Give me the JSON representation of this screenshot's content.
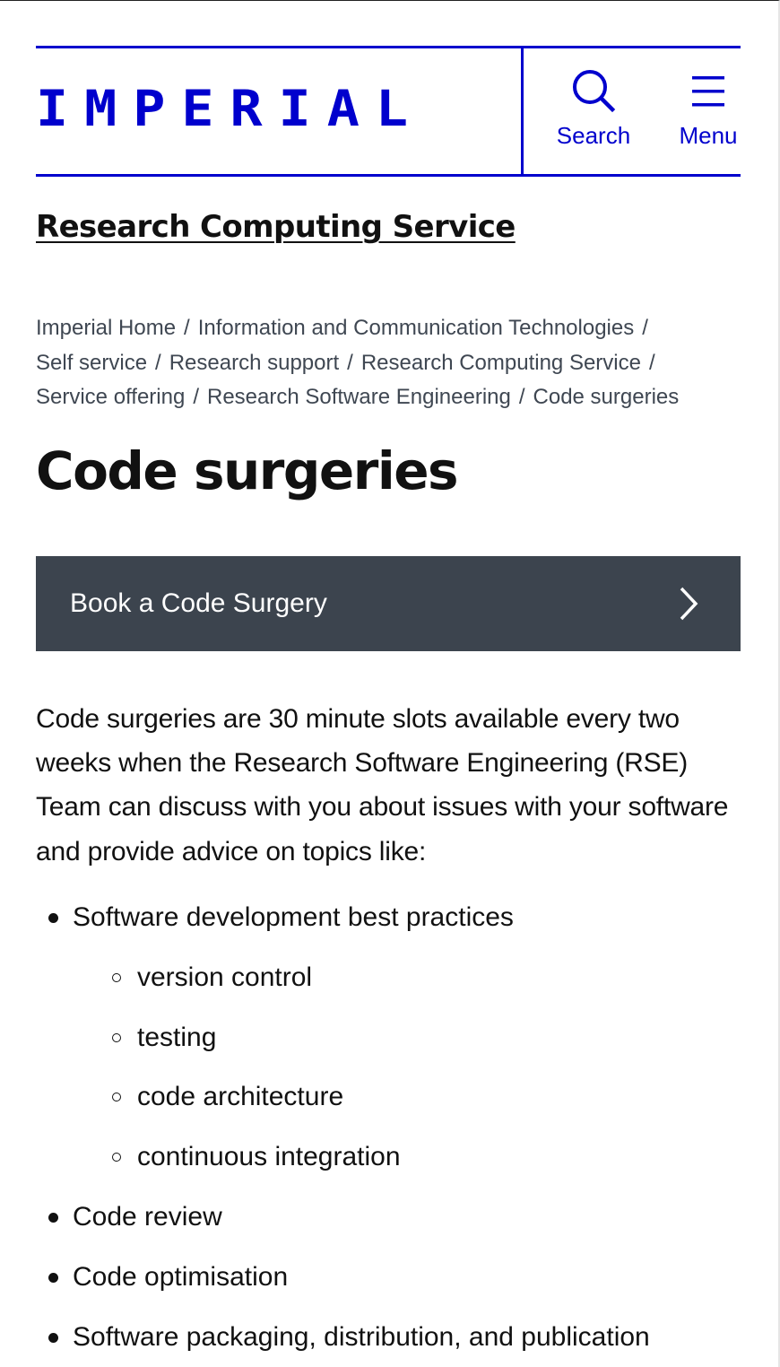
{
  "header": {
    "logo_text": "IMPERIAL",
    "search_label": "Search",
    "menu_label": "Menu",
    "brand_color": "#0000cd"
  },
  "site": {
    "title": "Research Computing Service"
  },
  "breadcrumb": {
    "items": [
      "Imperial Home",
      "Information and Communication Technologies",
      "Self service",
      "Research support",
      "Research Computing Service",
      "Service offering",
      "Research Software Engineering",
      "Code surgeries"
    ],
    "separator": "/"
  },
  "page": {
    "title": "Code surgeries",
    "cta_label": "Book a Code Surgery",
    "cta_color": "#3c444e",
    "intro": "Code surgeries are 30 minute slots available every two weeks when the Research Software Engineering (RSE) Team can discuss with you about issues with your software and provide advice on topics like:"
  },
  "topics": [
    {
      "text": "Software development best practices",
      "level": 1
    },
    {
      "text": "version control",
      "level": 2
    },
    {
      "text": "testing",
      "level": 2
    },
    {
      "text": "code architecture",
      "level": 2
    },
    {
      "text": "continuous integration",
      "level": 2
    },
    {
      "text": "Code review",
      "level": 1
    },
    {
      "text": "Code optimisation",
      "level": 1
    },
    {
      "text": "Software packaging, distribution, and publication",
      "level": 1
    }
  ]
}
